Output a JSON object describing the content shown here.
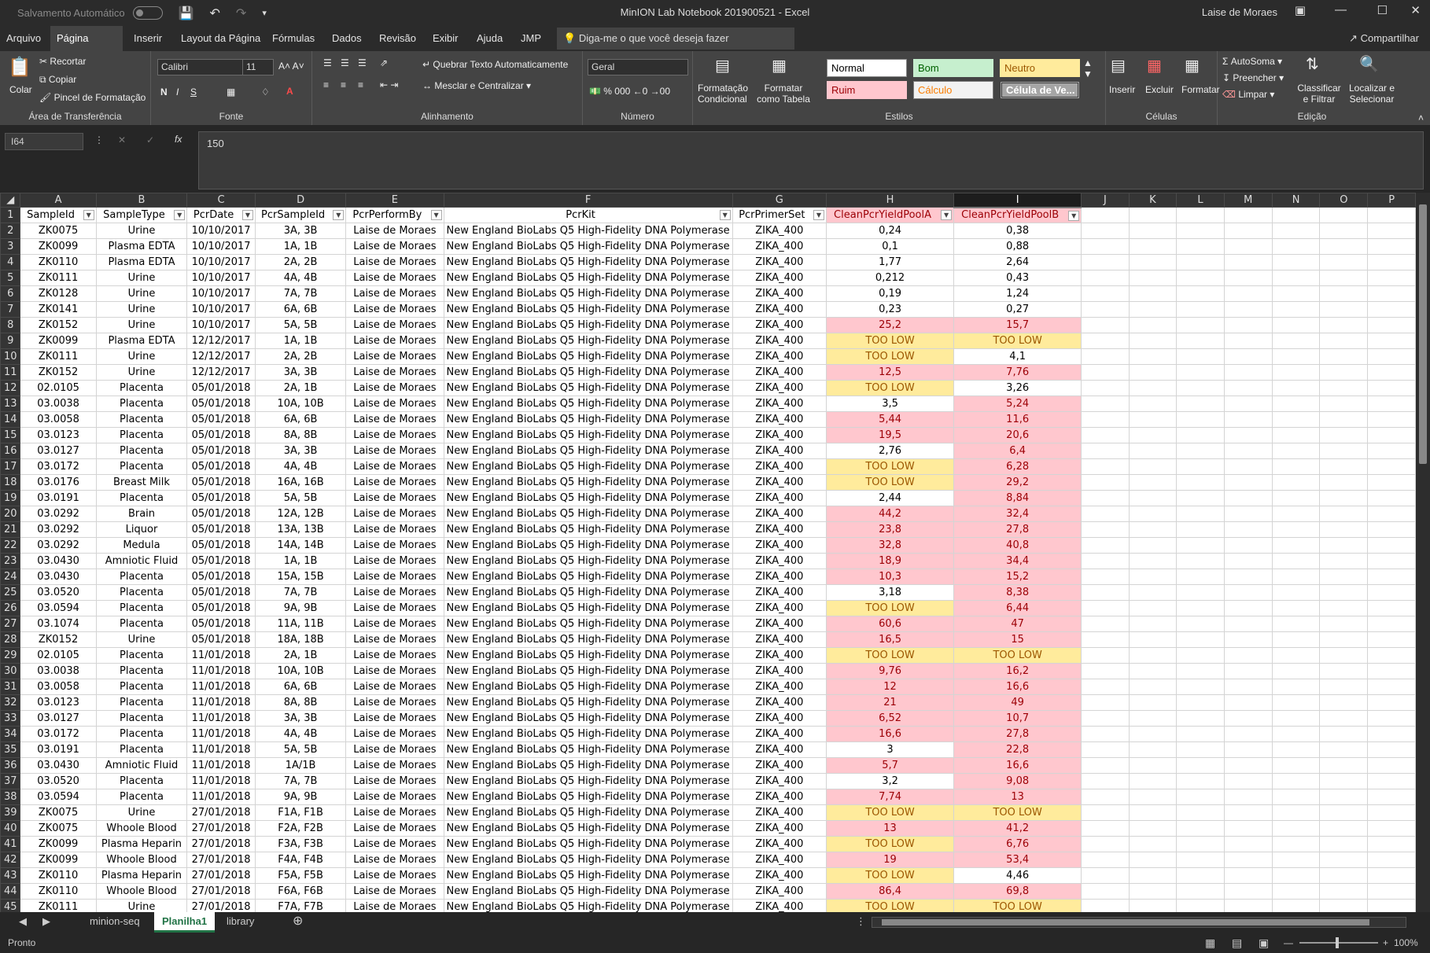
{
  "app": {
    "autosave_label": "Salvamento Automático",
    "window_title": "MinION Lab Notebook 201900521  -  Excel",
    "user": "Laise de Moraes"
  },
  "tabs": [
    "Arquivo",
    "Página Inicial",
    "Inserir",
    "Layout da Página",
    "Fórmulas",
    "Dados",
    "Revisão",
    "Exibir",
    "Ajuda",
    "JMP"
  ],
  "tell_me": "Diga-me o que você deseja fazer",
  "share": "Compartilhar",
  "ribbon": {
    "clipboard": {
      "paste": "Colar",
      "cut": "Recortar",
      "copy": "Copiar",
      "format_painter": "Pincel de Formatação",
      "label": "Área de Transferência"
    },
    "font": {
      "name": "Calibri",
      "size": "11",
      "label": "Fonte"
    },
    "alignment": {
      "wrap": "Quebrar Texto Automaticamente",
      "merge": "Mesclar e Centralizar",
      "label": "Alinhamento"
    },
    "number": {
      "format": "Geral",
      "label": "Número"
    },
    "styles": {
      "conditional": "Formatação Condicional",
      "table": "Formatar como Tabela",
      "normal": "Normal",
      "good": "Bom",
      "neutral": "Neutro",
      "bad": "Ruim",
      "calc": "Cálculo",
      "check": "Célula de Ve...",
      "label": "Estilos"
    },
    "cells": {
      "insert": "Inserir",
      "delete": "Excluir",
      "format": "Formatar",
      "label": "Células"
    },
    "editing": {
      "autosum": "AutoSoma",
      "fill": "Preencher",
      "clear": "Limpar",
      "sort": "Classificar e Filtrar",
      "find": "Localizar e Selecionar",
      "label": "Edição"
    },
    "colors": {
      "good": "#c6efce",
      "neutral": "#ffeb9c",
      "bad": "#ffc7ce"
    }
  },
  "formula": {
    "cell_ref": "I64",
    "value": "150"
  },
  "grid": {
    "columns": [
      "A",
      "B",
      "C",
      "D",
      "E",
      "F",
      "G",
      "H",
      "I",
      "J",
      "K",
      "L",
      "M",
      "N",
      "O",
      "P"
    ],
    "selected_column": "I",
    "headers": [
      "SampleId",
      "SampleType",
      "PcrDate",
      "PcrSampleId",
      "PcrPerformBy",
      "PcrKit",
      "PcrPrimerSet",
      "CleanPcrYieldPoolA",
      "CleanPcrYieldPoolB"
    ],
    "rows": [
      [
        "ZK0075",
        "Urine",
        "10/10/2017",
        "3A, 3B",
        "Laise de Moraes",
        "New England BioLabs Q5 High-Fidelity DNA Polymerase",
        "ZIKA_400",
        "0,24",
        "0,38"
      ],
      [
        "ZK0099",
        "Plasma EDTA",
        "10/10/2017",
        "1A, 1B",
        "Laise de Moraes",
        "New England BioLabs Q5 High-Fidelity DNA Polymerase",
        "ZIKA_400",
        "0,1",
        "0,88"
      ],
      [
        "ZK0110",
        "Plasma EDTA",
        "10/10/2017",
        "2A, 2B",
        "Laise de Moraes",
        "New England BioLabs Q5 High-Fidelity DNA Polymerase",
        "ZIKA_400",
        "1,77",
        "2,64"
      ],
      [
        "ZK0111",
        "Urine",
        "10/10/2017",
        "4A, 4B",
        "Laise de Moraes",
        "New England BioLabs Q5 High-Fidelity DNA Polymerase",
        "ZIKA_400",
        "0,212",
        "0,43"
      ],
      [
        "ZK0128",
        "Urine",
        "10/10/2017",
        "7A, 7B",
        "Laise de Moraes",
        "New England BioLabs Q5 High-Fidelity DNA Polymerase",
        "ZIKA_400",
        "0,19",
        "1,24"
      ],
      [
        "ZK0141",
        "Urine",
        "10/10/2017",
        "6A, 6B",
        "Laise de Moraes",
        "New England BioLabs Q5 High-Fidelity DNA Polymerase",
        "ZIKA_400",
        "0,23",
        "0,27"
      ],
      [
        "ZK0152",
        "Urine",
        "10/10/2017",
        "5A, 5B",
        "Laise de Moraes",
        "New England BioLabs Q5 High-Fidelity DNA Polymerase",
        "ZIKA_400",
        "25,2",
        "15,7"
      ],
      [
        "ZK0099",
        "Plasma EDTA",
        "12/12/2017",
        "1A, 1B",
        "Laise de Moraes",
        "New England BioLabs Q5 High-Fidelity DNA Polymerase",
        "ZIKA_400",
        "TOO LOW",
        "TOO LOW"
      ],
      [
        "ZK0111",
        "Urine",
        "12/12/2017",
        "2A, 2B",
        "Laise de Moraes",
        "New England BioLabs Q5 High-Fidelity DNA Polymerase",
        "ZIKA_400",
        "TOO LOW",
        "4,1"
      ],
      [
        "ZK0152",
        "Urine",
        "12/12/2017",
        "3A, 3B",
        "Laise de Moraes",
        "New England BioLabs Q5 High-Fidelity DNA Polymerase",
        "ZIKA_400",
        "12,5",
        "7,76"
      ],
      [
        "02.0105",
        "Placenta",
        "05/01/2018",
        "2A, 1B",
        "Laise de Moraes",
        "New England BioLabs Q5 High-Fidelity DNA Polymerase",
        "ZIKA_400",
        "TOO LOW",
        "3,26"
      ],
      [
        "03.0038",
        "Placenta",
        "05/01/2018",
        "10A, 10B",
        "Laise de Moraes",
        "New England BioLabs Q5 High-Fidelity DNA Polymerase",
        "ZIKA_400",
        "3,5",
        "5,24"
      ],
      [
        "03.0058",
        "Placenta",
        "05/01/2018",
        "6A, 6B",
        "Laise de Moraes",
        "New England BioLabs Q5 High-Fidelity DNA Polymerase",
        "ZIKA_400",
        "5,44",
        "11,6"
      ],
      [
        "03.0123",
        "Placenta",
        "05/01/2018",
        "8A, 8B",
        "Laise de Moraes",
        "New England BioLabs Q5 High-Fidelity DNA Polymerase",
        "ZIKA_400",
        "19,5",
        "20,6"
      ],
      [
        "03.0127",
        "Placenta",
        "05/01/2018",
        "3A, 3B",
        "Laise de Moraes",
        "New England BioLabs Q5 High-Fidelity DNA Polymerase",
        "ZIKA_400",
        "2,76",
        "6,4"
      ],
      [
        "03.0172",
        "Placenta",
        "05/01/2018",
        "4A, 4B",
        "Laise de Moraes",
        "New England BioLabs Q5 High-Fidelity DNA Polymerase",
        "ZIKA_400",
        "TOO LOW",
        "6,28"
      ],
      [
        "03.0176",
        "Breast Milk",
        "05/01/2018",
        "16A, 16B",
        "Laise de Moraes",
        "New England BioLabs Q5 High-Fidelity DNA Polymerase",
        "ZIKA_400",
        "TOO LOW",
        "29,2"
      ],
      [
        "03.0191",
        "Placenta",
        "05/01/2018",
        "5A, 5B",
        "Laise de Moraes",
        "New England BioLabs Q5 High-Fidelity DNA Polymerase",
        "ZIKA_400",
        "2,44",
        "8,84"
      ],
      [
        "03.0292",
        "Brain",
        "05/01/2018",
        "12A, 12B",
        "Laise de Moraes",
        "New England BioLabs Q5 High-Fidelity DNA Polymerase",
        "ZIKA_400",
        "44,2",
        "32,4"
      ],
      [
        "03.0292",
        "Liquor",
        "05/01/2018",
        "13A, 13B",
        "Laise de Moraes",
        "New England BioLabs Q5 High-Fidelity DNA Polymerase",
        "ZIKA_400",
        "23,8",
        "27,8"
      ],
      [
        "03.0292",
        "Medula",
        "05/01/2018",
        "14A, 14B",
        "Laise de Moraes",
        "New England BioLabs Q5 High-Fidelity DNA Polymerase",
        "ZIKA_400",
        "32,8",
        "40,8"
      ],
      [
        "03.0430",
        "Amniotic Fluid",
        "05/01/2018",
        "1A, 1B",
        "Laise de Moraes",
        "New England BioLabs Q5 High-Fidelity DNA Polymerase",
        "ZIKA_400",
        "18,9",
        "34,4"
      ],
      [
        "03.0430",
        "Placenta",
        "05/01/2018",
        "15A, 15B",
        "Laise de Moraes",
        "New England BioLabs Q5 High-Fidelity DNA Polymerase",
        "ZIKA_400",
        "10,3",
        "15,2"
      ],
      [
        "03.0520",
        "Placenta",
        "05/01/2018",
        "7A, 7B",
        "Laise de Moraes",
        "New England BioLabs Q5 High-Fidelity DNA Polymerase",
        "ZIKA_400",
        "3,18",
        "8,38"
      ],
      [
        "03.0594",
        "Placenta",
        "05/01/2018",
        "9A, 9B",
        "Laise de Moraes",
        "New England BioLabs Q5 High-Fidelity DNA Polymerase",
        "ZIKA_400",
        "TOO LOW",
        "6,44"
      ],
      [
        "03.1074",
        "Placenta",
        "05/01/2018",
        "11A, 11B",
        "Laise de Moraes",
        "New England BioLabs Q5 High-Fidelity DNA Polymerase",
        "ZIKA_400",
        "60,6",
        "47"
      ],
      [
        "ZK0152",
        "Urine",
        "05/01/2018",
        "18A, 18B",
        "Laise de Moraes",
        "New England BioLabs Q5 High-Fidelity DNA Polymerase",
        "ZIKA_400",
        "16,5",
        "15"
      ],
      [
        "02.0105",
        "Placenta",
        "11/01/2018",
        "2A, 1B",
        "Laise de Moraes",
        "New England BioLabs Q5 High-Fidelity DNA Polymerase",
        "ZIKA_400",
        "TOO LOW",
        "TOO LOW"
      ],
      [
        "03.0038",
        "Placenta",
        "11/01/2018",
        "10A, 10B",
        "Laise de Moraes",
        "New England BioLabs Q5 High-Fidelity DNA Polymerase",
        "ZIKA_400",
        "9,76",
        "16,2"
      ],
      [
        "03.0058",
        "Placenta",
        "11/01/2018",
        "6A, 6B",
        "Laise de Moraes",
        "New England BioLabs Q5 High-Fidelity DNA Polymerase",
        "ZIKA_400",
        "12",
        "16,6"
      ],
      [
        "03.0123",
        "Placenta",
        "11/01/2018",
        "8A, 8B",
        "Laise de Moraes",
        "New England BioLabs Q5 High-Fidelity DNA Polymerase",
        "ZIKA_400",
        "21",
        "49"
      ],
      [
        "03.0127",
        "Placenta",
        "11/01/2018",
        "3A, 3B",
        "Laise de Moraes",
        "New England BioLabs Q5 High-Fidelity DNA Polymerase",
        "ZIKA_400",
        "6,52",
        "10,7"
      ],
      [
        "03.0172",
        "Placenta",
        "11/01/2018",
        "4A, 4B",
        "Laise de Moraes",
        "New England BioLabs Q5 High-Fidelity DNA Polymerase",
        "ZIKA_400",
        "16,6",
        "27,8"
      ],
      [
        "03.0191",
        "Placenta",
        "11/01/2018",
        "5A, 5B",
        "Laise de Moraes",
        "New England BioLabs Q5 High-Fidelity DNA Polymerase",
        "ZIKA_400",
        "3",
        "22,8"
      ],
      [
        "03.0430",
        "Amniotic Fluid",
        "11/01/2018",
        "1A/1B",
        "Laise de Moraes",
        "New England BioLabs Q5 High-Fidelity DNA Polymerase",
        "ZIKA_400",
        "5,7",
        "16,6"
      ],
      [
        "03.0520",
        "Placenta",
        "11/01/2018",
        "7A, 7B",
        "Laise de Moraes",
        "New England BioLabs Q5 High-Fidelity DNA Polymerase",
        "ZIKA_400",
        "3,2",
        "9,08"
      ],
      [
        "03.0594",
        "Placenta",
        "11/01/2018",
        "9A, 9B",
        "Laise de Moraes",
        "New England BioLabs Q5 High-Fidelity DNA Polymerase",
        "ZIKA_400",
        "7,74",
        "13"
      ],
      [
        "ZK0075",
        "Urine",
        "27/01/2018",
        "F1A, F1B",
        "Laise de Moraes",
        "New England BioLabs Q5 High-Fidelity DNA Polymerase",
        "ZIKA_400",
        "TOO LOW",
        "TOO LOW"
      ],
      [
        "ZK0075",
        "Whoole Blood",
        "27/01/2018",
        "F2A, F2B",
        "Laise de Moraes",
        "New England BioLabs Q5 High-Fidelity DNA Polymerase",
        "ZIKA_400",
        "13",
        "41,2"
      ],
      [
        "ZK0099",
        "Plasma Heparin",
        "27/01/2018",
        "F3A, F3B",
        "Laise de Moraes",
        "New England BioLabs Q5 High-Fidelity DNA Polymerase",
        "ZIKA_400",
        "TOO LOW",
        "6,76"
      ],
      [
        "ZK0099",
        "Whoole Blood",
        "27/01/2018",
        "F4A, F4B",
        "Laise de Moraes",
        "New England BioLabs Q5 High-Fidelity DNA Polymerase",
        "ZIKA_400",
        "19",
        "53,4"
      ],
      [
        "ZK0110",
        "Plasma Heparin",
        "27/01/2018",
        "F5A, F5B",
        "Laise de Moraes",
        "New England BioLabs Q5 High-Fidelity DNA Polymerase",
        "ZIKA_400",
        "TOO LOW",
        "4,46"
      ],
      [
        "ZK0110",
        "Whoole Blood",
        "27/01/2018",
        "F6A, F6B",
        "Laise de Moraes",
        "New England BioLabs Q5 High-Fidelity DNA Polymerase",
        "ZIKA_400",
        "86,4",
        "69,8"
      ],
      [
        "ZK0111",
        "Urine",
        "27/01/2018",
        "F7A, F7B",
        "Laise de Moraes",
        "New England BioLabs Q5 High-Fidelity DNA Polymerase",
        "ZIKA_400",
        "TOO LOW",
        "TOO LOW"
      ]
    ]
  },
  "sheets": [
    "minion-seq",
    "Planilha1",
    "library"
  ],
  "active_sheet": "Planilha1",
  "status": {
    "ready": "Pronto",
    "zoom": "100%"
  }
}
